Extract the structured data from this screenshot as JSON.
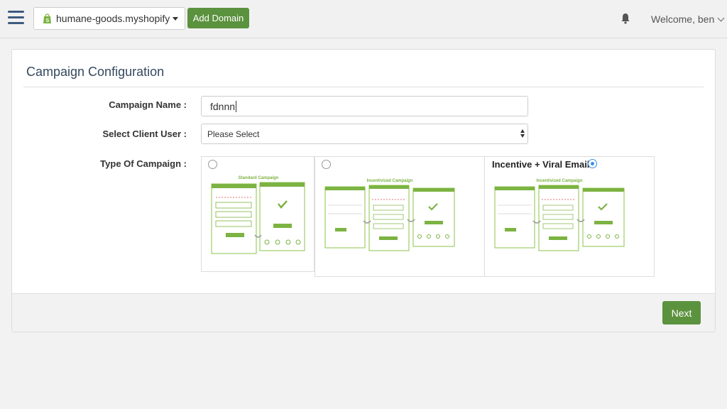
{
  "topbar": {
    "store_name": "humane-goods.myshopify",
    "add_domain_label": "Add Domain",
    "welcome_text": "Welcome, ben"
  },
  "panel": {
    "title": "Campaign Configuration",
    "fields": {
      "campaign_name_label": "Campaign Name :",
      "campaign_name_value": "fdnnn",
      "client_user_label": "Select Client User :",
      "client_user_selected": "Please Select",
      "campaign_type_label": "Type Of Campaign :"
    },
    "campaign_types": [
      {
        "title": "",
        "caption": "Standard Campaign",
        "selected": false
      },
      {
        "title": "",
        "caption": "Incentivized Campaign",
        "selected": false
      },
      {
        "title": "Incentive + Viral Email",
        "caption": "Incentivized Campaign",
        "selected": true
      }
    ],
    "next_label": "Next"
  },
  "colors": {
    "accent_green": "#5b923e",
    "radio_blue": "#3c8ee8",
    "title_blue": "#34495e"
  }
}
